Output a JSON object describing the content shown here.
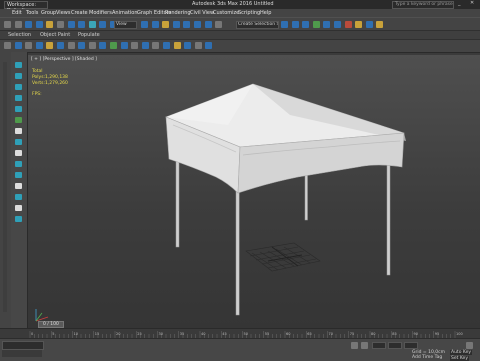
{
  "window": {
    "workspace_label": "Workspace: Default",
    "title": "Autodesk 3ds Max 2016    Untitled",
    "search_placeholder": "Type a keyword or phrase"
  },
  "menus": [
    "Edit",
    "Tools",
    "Group",
    "Views",
    "Create",
    "Modifiers",
    "Animation",
    "Graph Editors",
    "Rendering",
    "Civil View",
    "Customize",
    "Scripting",
    "Help"
  ],
  "toolbar": {
    "view_dropdown": "View",
    "selection_set": "Create Selection Se"
  },
  "ribbon_tabs": [
    "Selection",
    "Object Paint",
    "Populate"
  ],
  "viewport": {
    "label": "[ + ] [Perspective ] [Shaded ]",
    "stats_title": "Total",
    "polys_label": "Polys:",
    "polys_value": "1,290,138",
    "verts_label": "Verts:",
    "verts_value": "1,279,260",
    "fps_label": "FPS:"
  },
  "timeline": {
    "frame_counter": "0 / 100",
    "ticks": [
      "0",
      "5",
      "10",
      "15",
      "20",
      "25",
      "30",
      "35",
      "40",
      "45",
      "50",
      "55",
      "60",
      "65",
      "70",
      "75",
      "80",
      "85",
      "90",
      "95",
      "100"
    ]
  },
  "status": {
    "grid": "Grid = 10,0cm",
    "add_time_tag": "Add Time Tag",
    "auto_key": "Auto Key",
    "set_key": "Set Key"
  },
  "colors": {
    "accent": "#2f6fb1",
    "viewport_bg": "#474747",
    "stats_text": "#e6d94a",
    "tent": "#d9d9d9"
  }
}
